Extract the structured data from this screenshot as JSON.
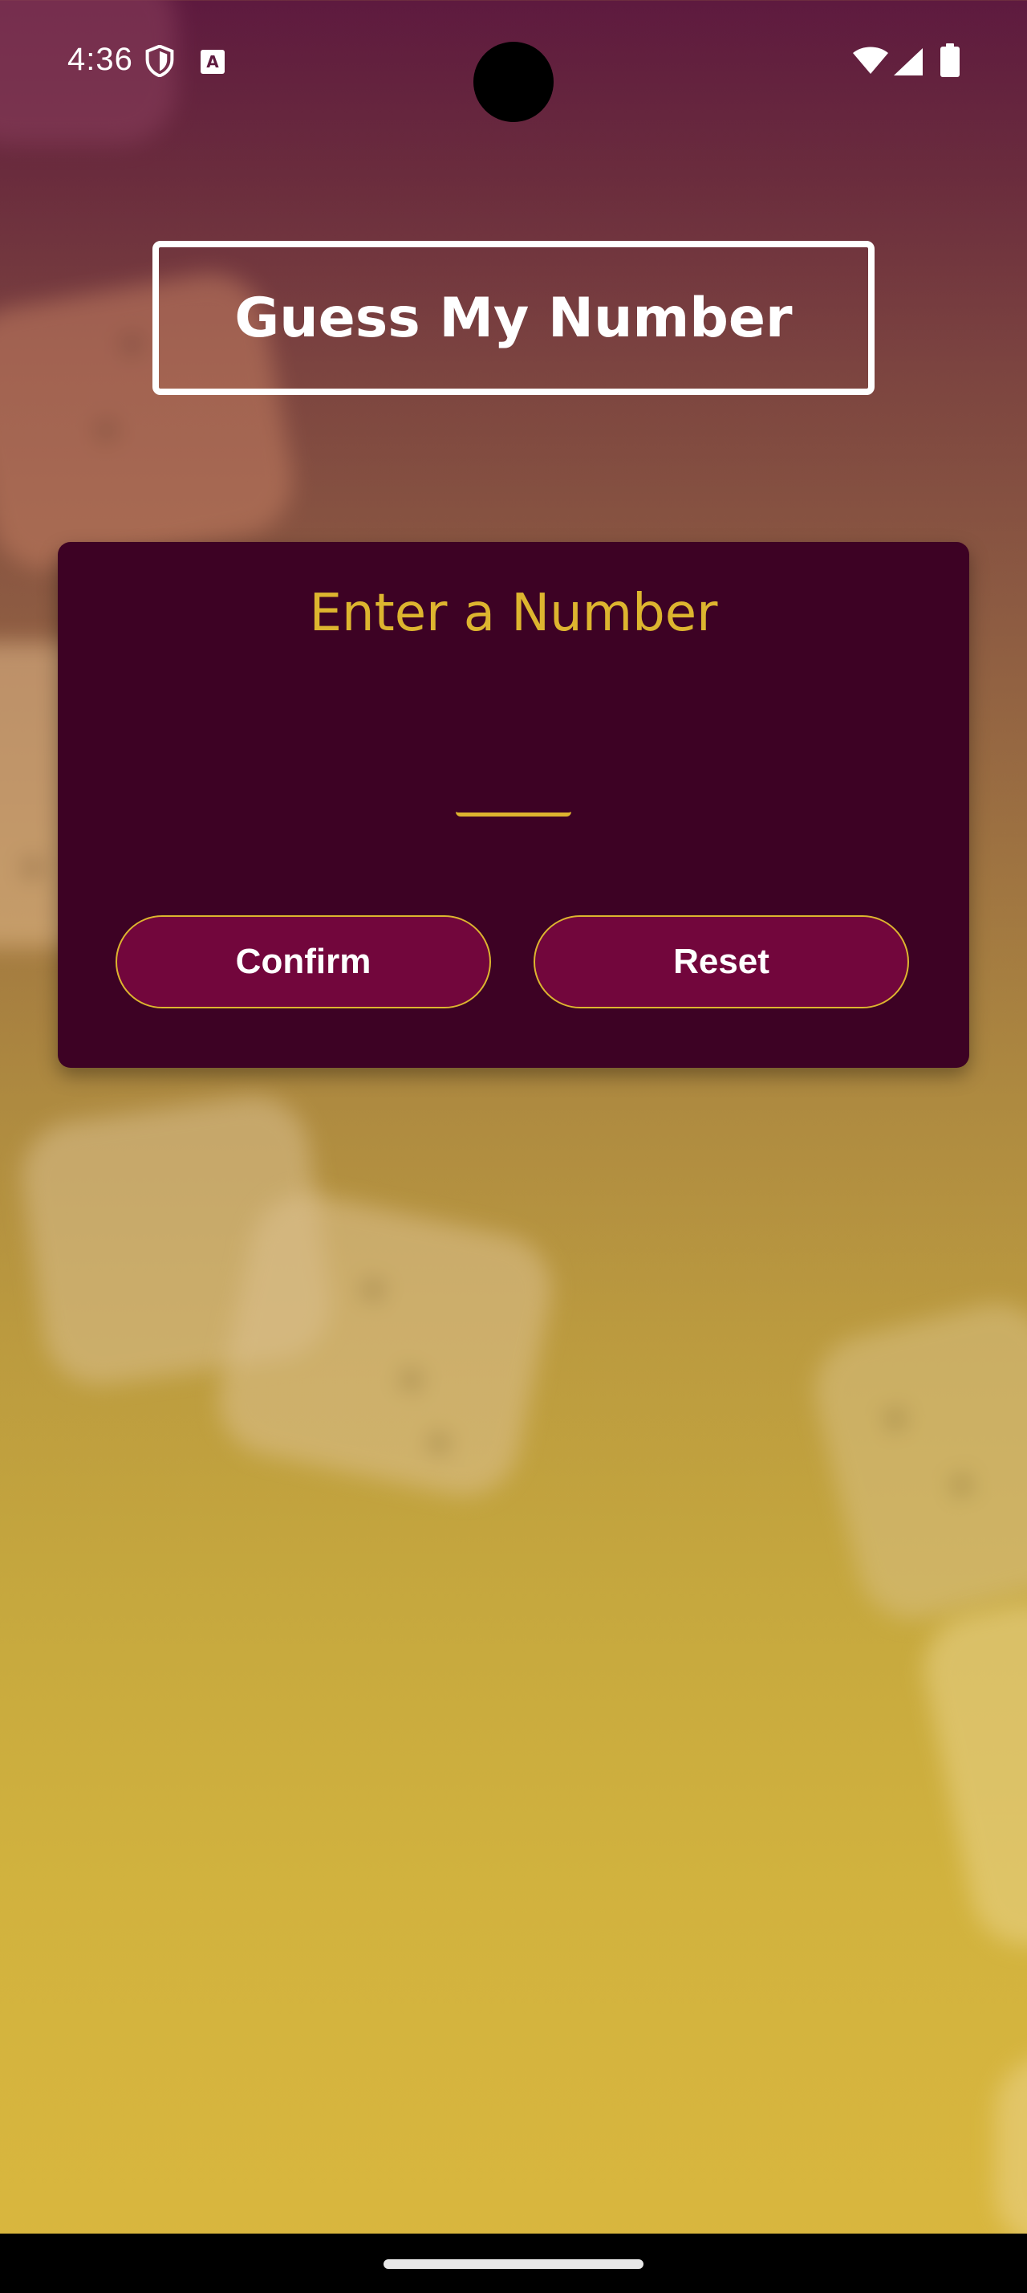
{
  "status_bar": {
    "time": "4:36",
    "icons": [
      "shield-icon",
      "text-a-icon",
      "wifi-icon",
      "signal-icon",
      "battery-icon"
    ],
    "a_icon_glyph": "A"
  },
  "app": {
    "title": "Guess My Number",
    "card": {
      "heading": "Enter a Number",
      "input_value": "",
      "confirm_label": "Confirm",
      "reset_label": "Reset"
    }
  },
  "colors": {
    "accent": "#ddb52f",
    "card_background": "#3d0224",
    "button_background": "#72063c",
    "gradient_top": "#5e1a3f",
    "gradient_bottom": "#dab73e"
  }
}
